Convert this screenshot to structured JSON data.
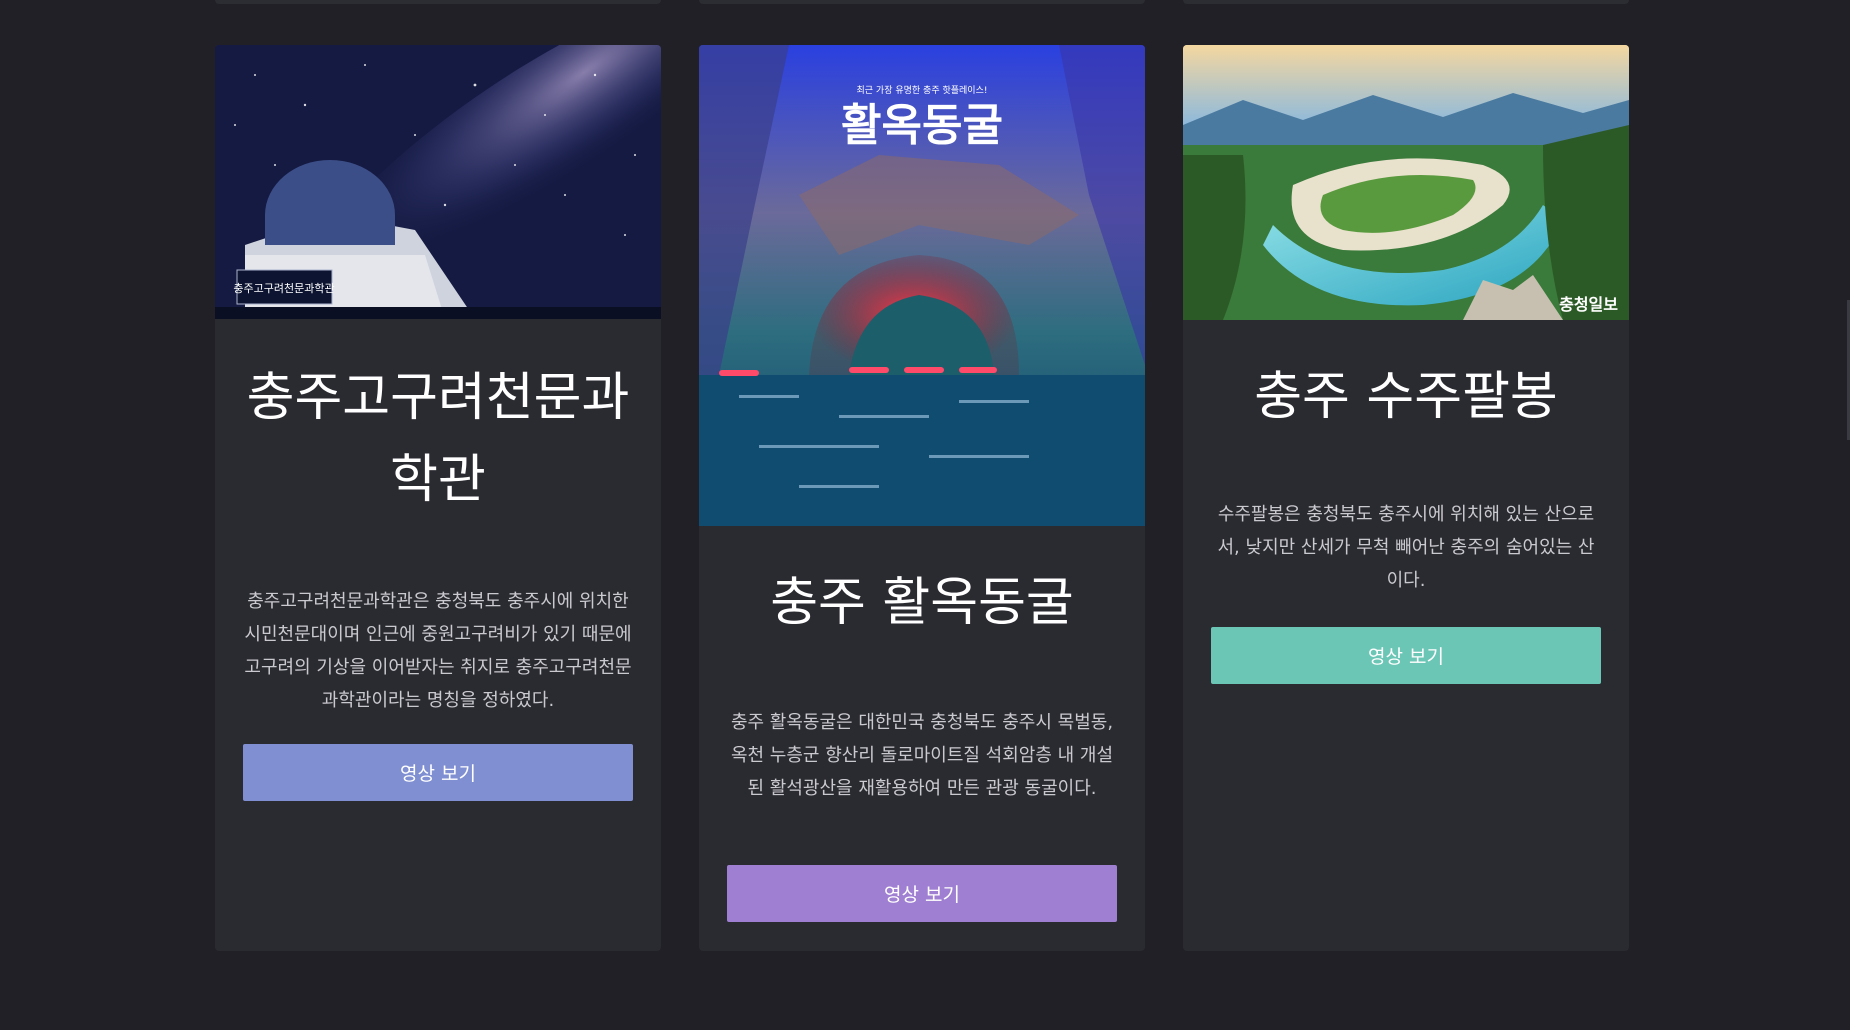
{
  "cards": [
    {
      "title": "충주고구려천문과학관",
      "image_alt": "충주고구려천문과학관 observatory under the milky way",
      "image_sign_text": "충주고구려천문과학관",
      "description": "충주고구려천문과학관은 충청북도 충주시에 위치한 시민천문대이며 인근에 중원고구려비가 있기 때문에 고구려의 기상을 이어받자는 취지로 충주고구려천문과학관이라는 명칭을 정하였다.",
      "button_label": "영상 보기",
      "button_color": "#7f8fd2"
    },
    {
      "title": "충주 활옥동굴",
      "image_alt": "활옥동굴 cave with boats",
      "image_caption_small": "최근 가장 유명한 충주 핫플레이스!",
      "image_caption_big": "활옥동굴",
      "description": "충주 활옥동굴은 대한민국 충청북도 충주시 목벌동, 옥천 누층군 향산리 돌로마이트질 석회암층 내 개설된 활석광산을 재활용하여 만든 관광 동굴이다.",
      "button_label": "영상 보기",
      "button_color": "#9f7fd2"
    },
    {
      "title": "충주 수주팔봉",
      "image_alt": "수주팔봉 river landscape",
      "image_watermark": "충청일보",
      "description": "수주팔봉은 충청북도 충주시에 위치해 있는 산으로서, 낮지만 산세가 무척 빼어난 충주의 숨어있는 산이다.",
      "button_label": "영상 보기",
      "button_color": "#6cc6b6"
    }
  ],
  "colors": {
    "background": "#202026",
    "card": "#2a2a31",
    "title_text": "#ffffff",
    "body_text": "#c9c9cf"
  }
}
